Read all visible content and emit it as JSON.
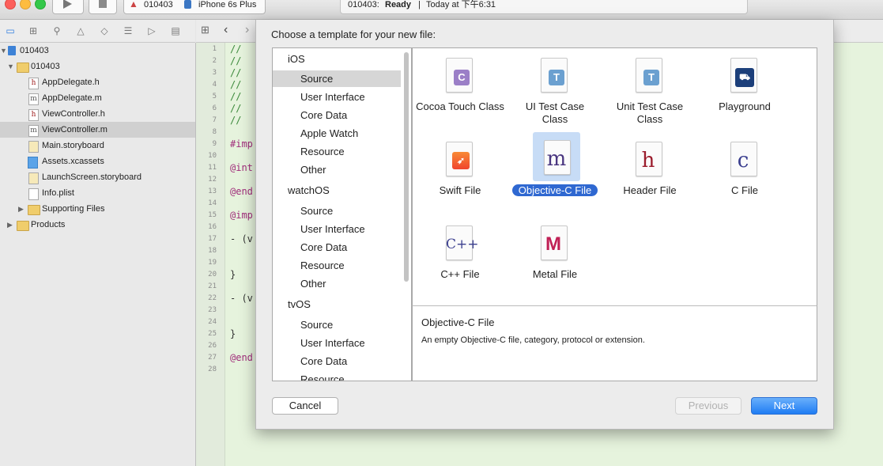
{
  "toolbar": {
    "scheme_project": "010403",
    "scheme_device": "iPhone 6s Plus",
    "status_project": "010403:",
    "status_state": "Ready",
    "status_sep": "|",
    "status_time": "Today at 下午6:31"
  },
  "navigator": {
    "rows": [
      {
        "label": "010403"
      },
      {
        "label": "010403"
      },
      {
        "label": "AppDelegate.h",
        "icon": "h"
      },
      {
        "label": "AppDelegate.m",
        "icon": "m"
      },
      {
        "label": "ViewController.h",
        "icon": "h"
      },
      {
        "label": "ViewController.m",
        "icon": "m"
      },
      {
        "label": "Main.storyboard"
      },
      {
        "label": "Assets.xcassets"
      },
      {
        "label": "LaunchScreen.storyboard"
      },
      {
        "label": "Info.plist"
      },
      {
        "label": "Supporting Files"
      },
      {
        "label": "Products"
      }
    ]
  },
  "editor": {
    "line_numbers": [
      "1",
      "2",
      "3",
      "4",
      "5",
      "6",
      "7",
      "8",
      "9",
      "10",
      "11",
      "12",
      "13",
      "14",
      "15",
      "16",
      "17",
      "18",
      "19",
      "20",
      "21",
      "22",
      "23",
      "24",
      "25",
      "26",
      "27",
      "28"
    ],
    "lines": [
      "//",
      "//",
      "//",
      "//",
      "//",
      "//",
      "//",
      "#imp",
      "@int",
      "@end",
      "@imp",
      "- (v",
      "}",
      "- (v",
      "}",
      "@end"
    ]
  },
  "sheet": {
    "title": "Choose a template for your new file:",
    "platforms": [
      {
        "name": "iOS",
        "items": [
          "Source",
          "User Interface",
          "Core Data",
          "Apple Watch",
          "Resource",
          "Other"
        ]
      },
      {
        "name": "watchOS",
        "items": [
          "Source",
          "User Interface",
          "Core Data",
          "Resource",
          "Other"
        ]
      },
      {
        "name": "tvOS",
        "items": [
          "Source",
          "User Interface",
          "Core Data",
          "Resource"
        ]
      }
    ],
    "templates": [
      {
        "label": "Cocoa Touch Class",
        "glyph": "C"
      },
      {
        "label": "UI Test Case Class",
        "glyph": "T"
      },
      {
        "label": "Unit Test Case Class",
        "glyph": "T"
      },
      {
        "label": "Playground",
        "glyph": ""
      },
      {
        "label": "Swift File",
        "glyph": ""
      },
      {
        "label": "Objective-C File",
        "glyph": "m"
      },
      {
        "label": "Header File",
        "glyph": "h"
      },
      {
        "label": "C File",
        "glyph": "c"
      },
      {
        "label": "C++ File",
        "glyph": "C++"
      },
      {
        "label": "Metal File",
        "glyph": "M"
      }
    ],
    "description_title": "Objective-C File",
    "description_text": "An empty Objective-C file, category, protocol or extension.",
    "cancel_label": "Cancel",
    "previous_label": "Previous",
    "next_label": "Next"
  },
  "colors": {
    "accent": "#2f68d1",
    "next_button": "#1f7cf3",
    "editor_bg": "#e6f3dd",
    "selection_tile": "#c7dcf6"
  }
}
